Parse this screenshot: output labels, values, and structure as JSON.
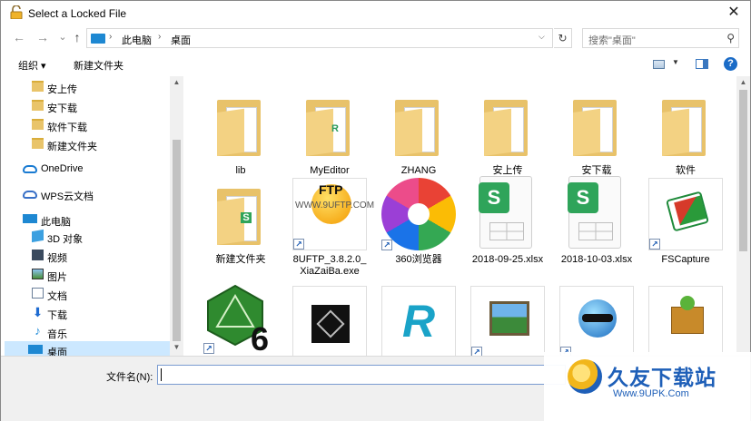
{
  "window": {
    "title": "Select a Locked File",
    "close_glyph": "✕"
  },
  "nav": {
    "back_glyph": "←",
    "forward_glyph": "→",
    "recent_glyph": "⌄",
    "up_glyph": "↑",
    "breadcrumb": [
      "此电脑",
      "桌面"
    ],
    "separator": "›",
    "refresh_glyph": "↻",
    "search_placeholder": "搜索\"桌面\"",
    "search_glyph": "⚲"
  },
  "toolbar": {
    "organize": "组织 ▾",
    "new_folder": "新建文件夹",
    "help": "?"
  },
  "sidebar": {
    "items": [
      {
        "label": "安上传",
        "icon": "folder-icon"
      },
      {
        "label": "安下载",
        "icon": "folder-icon"
      },
      {
        "label": "软件下载",
        "icon": "folder-icon"
      },
      {
        "label": "新建文件夹",
        "icon": "folder-icon"
      },
      {
        "label": "OneDrive",
        "icon": "onedrive-icon"
      },
      {
        "label": "WPS云文档",
        "icon": "wps-cloud-icon"
      },
      {
        "label": "此电脑",
        "icon": "computer-icon"
      },
      {
        "label": "3D 对象",
        "icon": "3d-objects-icon"
      },
      {
        "label": "视频",
        "icon": "video-icon"
      },
      {
        "label": "图片",
        "icon": "pictures-icon"
      },
      {
        "label": "文档",
        "icon": "documents-icon"
      },
      {
        "label": "下载",
        "icon": "downloads-icon"
      },
      {
        "label": "音乐",
        "icon": "music-icon"
      },
      {
        "label": "桌面",
        "icon": "desktop-icon",
        "selected": true
      }
    ]
  },
  "files": [
    {
      "label": "lib",
      "kind": "folder",
      "mark": ""
    },
    {
      "label": "MyEditor",
      "kind": "folder",
      "mark": "R"
    },
    {
      "label": "ZHANG",
      "kind": "folder",
      "mark": ""
    },
    {
      "label": "安上传",
      "kind": "folder",
      "mark": ""
    },
    {
      "label": "安下载",
      "kind": "folder",
      "mark": ""
    },
    {
      "label": "软件",
      "kind": "folder",
      "mark": ""
    },
    {
      "label": "新建文件夹",
      "kind": "folder",
      "mark": "S"
    },
    {
      "label": "8UFTP_3.8.2.0_XiaZaiBa.exe",
      "kind": "exe",
      "mark": "FTP",
      "overlay": "WWW.9UFTP.COM"
    },
    {
      "label": "360浏览器",
      "kind": "shortcut",
      "mark": ""
    },
    {
      "label": "2018-09-25.xlsx",
      "kind": "xlsx",
      "mark": "S"
    },
    {
      "label": "2018-10-03.xlsx",
      "kind": "xlsx",
      "mark": "S"
    },
    {
      "label": "FSCapture",
      "kind": "shortcut",
      "mark": ""
    },
    {
      "label": "",
      "kind": "shortcut",
      "mark": "6"
    },
    {
      "label": "",
      "kind": "app",
      "mark": ""
    },
    {
      "label": "",
      "kind": "app",
      "mark": "R"
    },
    {
      "label": "",
      "kind": "shortcut",
      "mark": ""
    },
    {
      "label": "",
      "kind": "shortcut",
      "mark": ""
    },
    {
      "label": "",
      "kind": "app",
      "mark": ""
    }
  ],
  "bottom": {
    "filename_label": "文件名(N):",
    "filename_value": ""
  },
  "watermark": {
    "title": "久友下载站",
    "url": "Www.9UPK.Com"
  },
  "colors": {
    "selection": "#cce8ff",
    "folder": "#e8c26a",
    "accent": "#1e88d2",
    "wps_green": "#2fa45a"
  }
}
